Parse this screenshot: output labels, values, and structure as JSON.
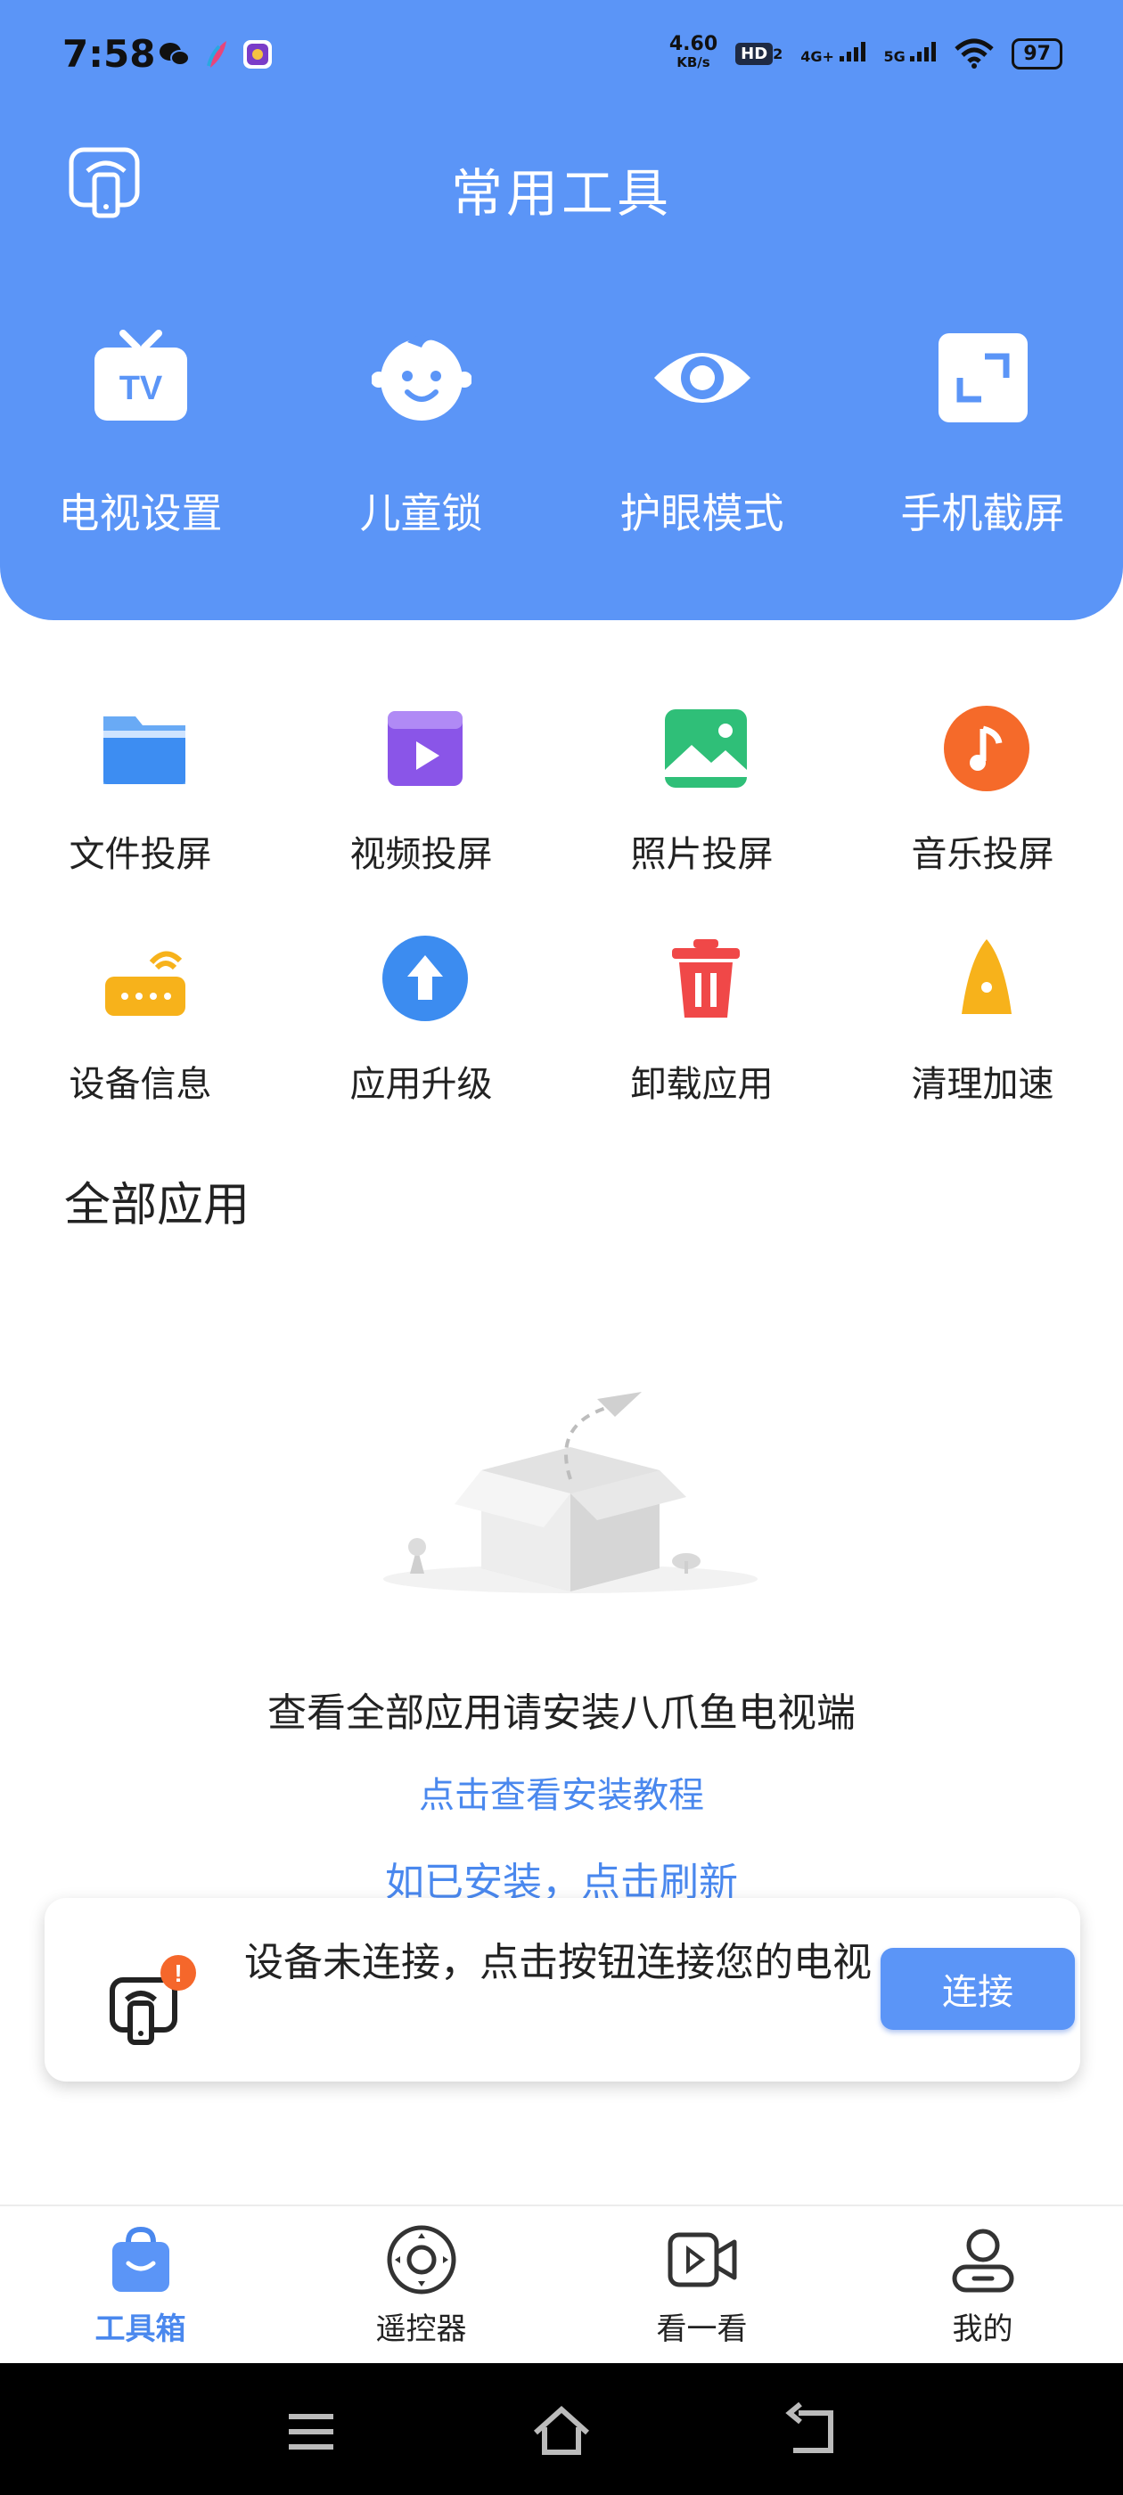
{
  "status_bar": {
    "time": "7:58",
    "net_speed_value": "4.60",
    "net_speed_unit": "KB/s",
    "hd_badge": "HD",
    "hd_sub": "2",
    "net_4g": "4G+",
    "net_5g": "5G",
    "battery": "97",
    "app_icons": [
      "wechat-icon",
      "feather-app-icon",
      "game-app-icon"
    ]
  },
  "header": {
    "title": "常用工具",
    "cast_icon": "cast-phone-icon"
  },
  "top_tools": [
    {
      "label": "电视设置",
      "icon": "tv-icon"
    },
    {
      "label": "儿童锁",
      "icon": "baby-face-icon"
    },
    {
      "label": "护眼模式",
      "icon": "eye-icon"
    },
    {
      "label": "手机截屏",
      "icon": "screenshot-icon"
    }
  ],
  "tools": [
    {
      "label": "文件投屏",
      "icon": "folder-icon"
    },
    {
      "label": "视频投屏",
      "icon": "video-icon"
    },
    {
      "label": "照片投屏",
      "icon": "photo-icon"
    },
    {
      "label": "音乐投屏",
      "icon": "music-icon"
    },
    {
      "label": "设备信息",
      "icon": "router-icon"
    },
    {
      "label": "应用升级",
      "icon": "upgrade-icon"
    },
    {
      "label": "卸载应用",
      "icon": "trash-icon"
    },
    {
      "label": "清理加速",
      "icon": "rocket-icon"
    }
  ],
  "all_apps": {
    "title": "全部应用",
    "empty_text": "查看全部应用请安装八爪鱼电视端",
    "tutorial_link": "点击查看安装教程",
    "refresh_link": "如已安装，点击刷新"
  },
  "connect": {
    "message": "设备未连接，点击按钮连接您的电视",
    "button": "连接",
    "badge": "!"
  },
  "bottom_nav": [
    {
      "label": "工具箱",
      "icon": "toolbox-bag-icon",
      "active": true
    },
    {
      "label": "遥控器",
      "icon": "remote-dpad-icon",
      "active": false
    },
    {
      "label": "看一看",
      "icon": "video-camera-icon",
      "active": false
    },
    {
      "label": "我的",
      "icon": "profile-icon",
      "active": false
    }
  ],
  "colors": {
    "primary": "#5b95f7",
    "link": "#4a88ee",
    "badge": "#f5672b"
  }
}
